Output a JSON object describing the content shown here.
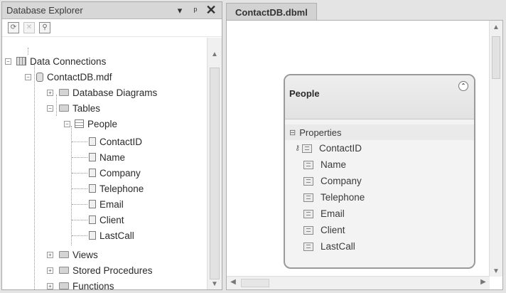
{
  "explorer": {
    "title": "Database Explorer",
    "dropdown_glyph": "▾",
    "pin_glyph": "ꟷ",
    "close_glyph": "✕",
    "toolbar": [
      "refresh-icon",
      "stop-icon",
      "connect-icon"
    ],
    "tree": {
      "root": "Data Connections",
      "db": "ContactDB.mdf",
      "diagrams": "Database Diagrams",
      "tables": "Tables",
      "people": "People",
      "columns": [
        "ContactID",
        "Name",
        "Company",
        "Telephone",
        "Email",
        "Client",
        "LastCall"
      ],
      "views": "Views",
      "procs": "Stored Procedures",
      "functions": "Functions"
    }
  },
  "designer": {
    "tab": "ContactDB.dbml",
    "entity": {
      "name": "People",
      "section": "Properties",
      "properties": [
        "ContactID",
        "Name",
        "Company",
        "Telephone",
        "Email",
        "Client",
        "LastCall"
      ]
    }
  }
}
